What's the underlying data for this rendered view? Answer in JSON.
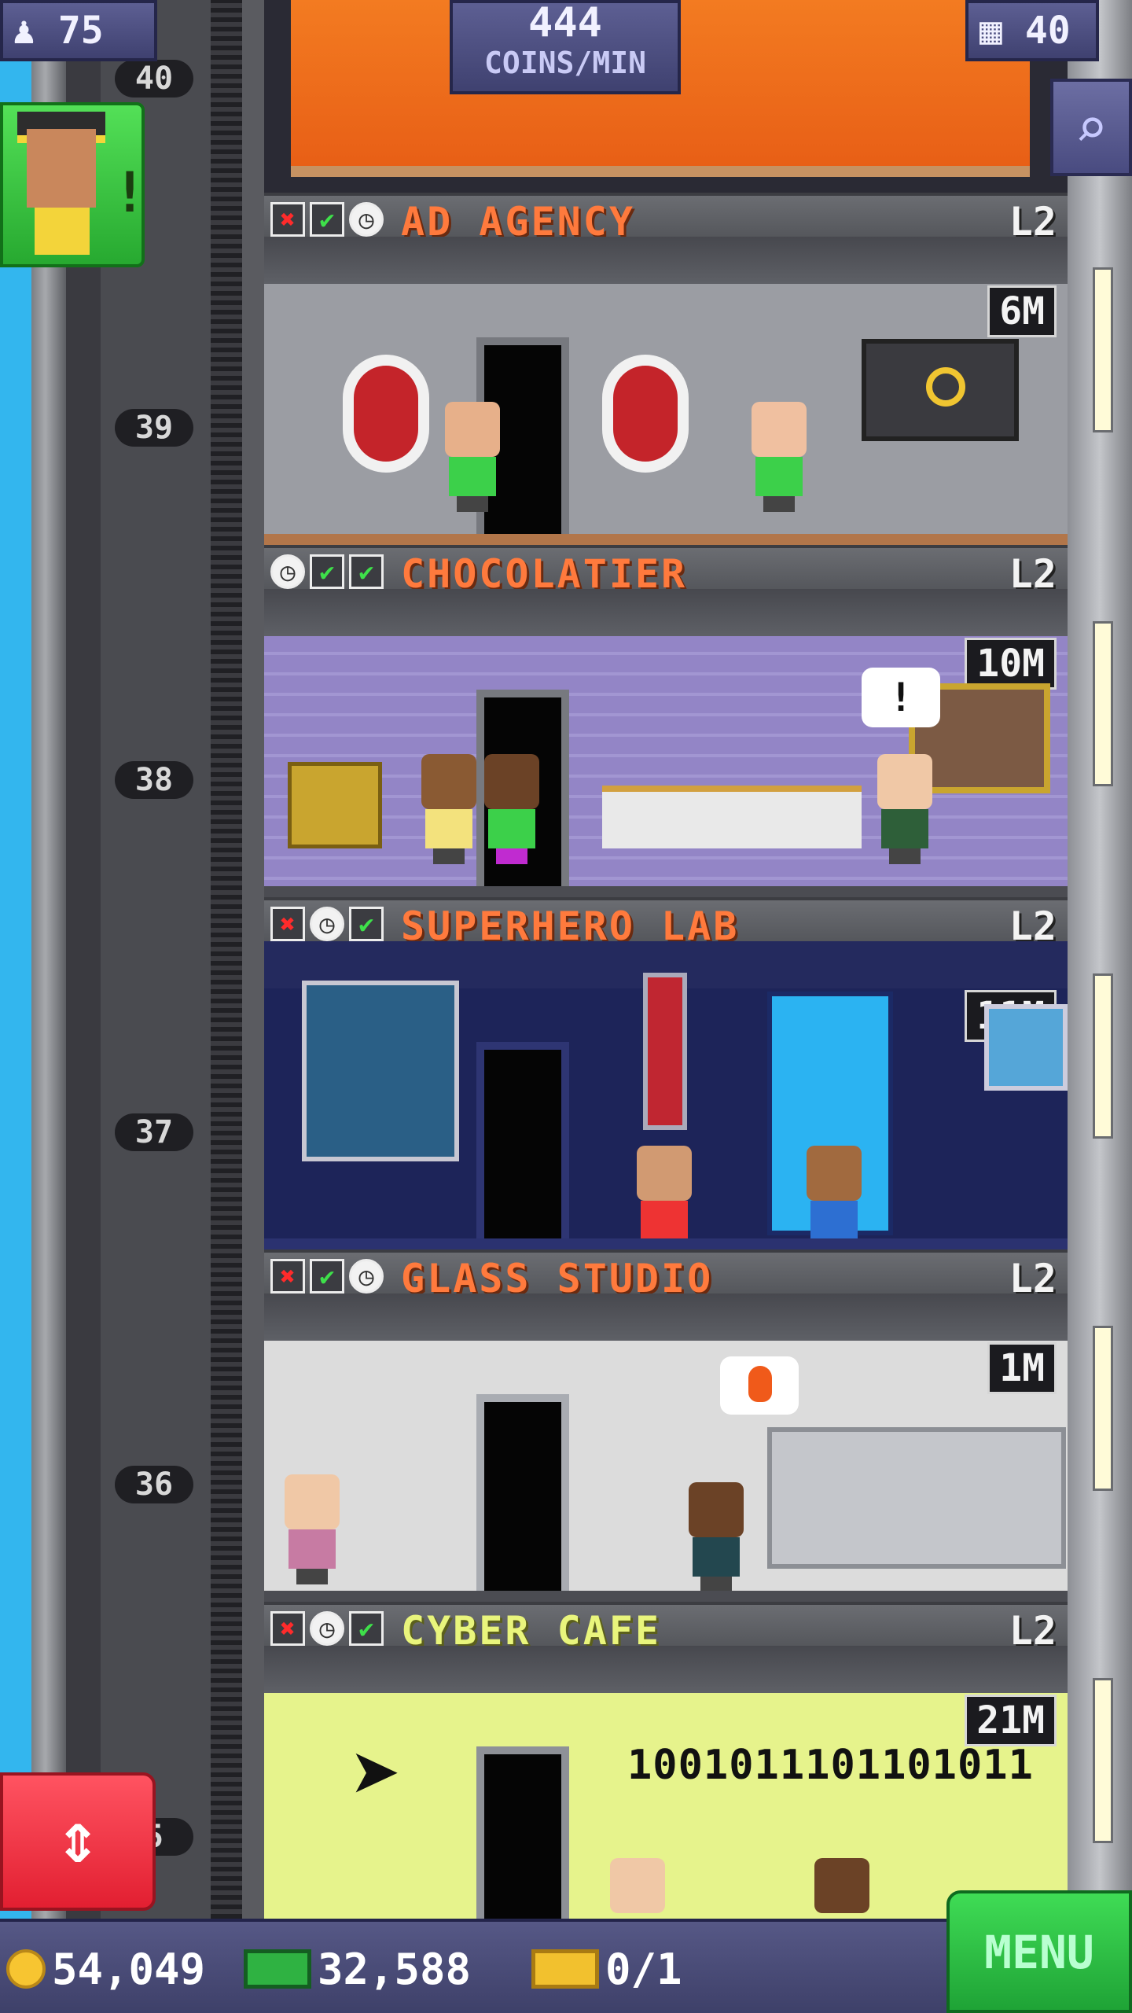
{
  "hud": {
    "population": "75",
    "coins_per_min": "444",
    "coins_per_min_label": "COINS/MIN",
    "floor_count": "40"
  },
  "shaft": {
    "floor_numbers": [
      "40",
      "39",
      "38",
      "37",
      "36",
      "5"
    ]
  },
  "floors": [
    {
      "name": "AD AGENCY",
      "level": "L2",
      "money": "6M",
      "status": [
        "x",
        "check",
        "clock"
      ],
      "theme": "#8c8e96"
    },
    {
      "name": "CHOCOLATIER",
      "level": "L2",
      "money": "10M",
      "status": [
        "clock",
        "check",
        "check"
      ],
      "theme": "#9b8fcf"
    },
    {
      "name": "SUPERHERO LAB",
      "level": "L2",
      "money": "11M",
      "status": [
        "x",
        "clock",
        "check"
      ],
      "theme": "#1f2559"
    },
    {
      "name": "GLASS STUDIO",
      "level": "L2",
      "money": "1M",
      "status": [
        "x",
        "check",
        "clock"
      ],
      "theme": "#dcdcdc"
    },
    {
      "name": "CYBER CAFE",
      "level": "L2",
      "money": "21M",
      "status": [
        "x",
        "clock",
        "check"
      ],
      "theme": "#e6f38c"
    }
  ],
  "cyber_cafe_binary": "1001011101101011",
  "bottom": {
    "coins": "54,049",
    "bux": "32,588",
    "tickets": "0/1",
    "menu_label": "MENU"
  },
  "colors": {
    "hud_bg": "#4c4e80",
    "menu_green": "#2fc347",
    "elevator_red": "#f0344a",
    "floor_name_orange": "#ff7a3d"
  }
}
